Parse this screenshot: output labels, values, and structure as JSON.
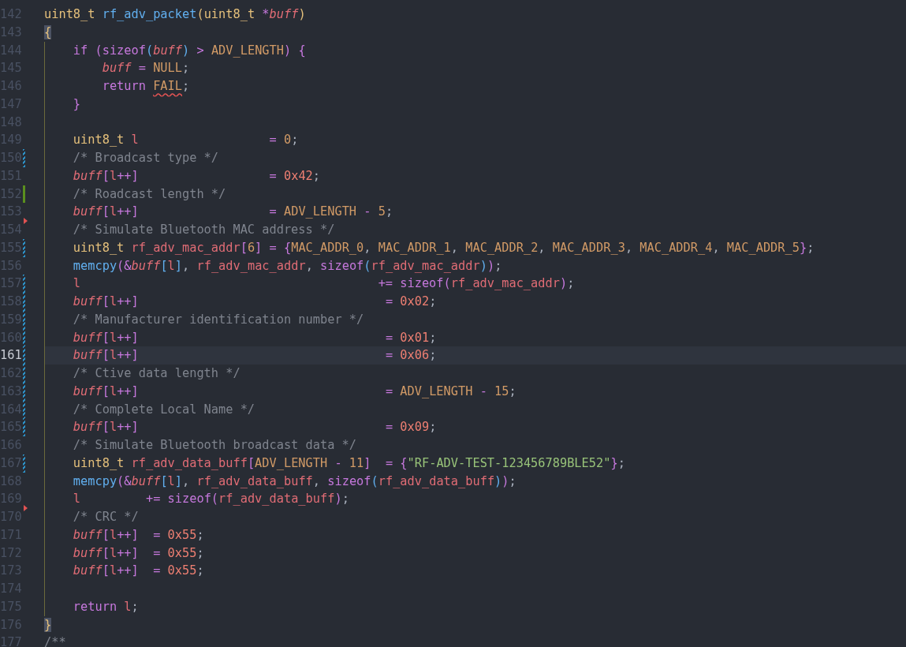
{
  "editor": {
    "lines": [
      {
        "number": "142",
        "current": false,
        "tokens": [
          {
            "text": "uint8_t ",
            "kind": "type"
          },
          {
            "text": "rf_adv_packet",
            "kind": "fn"
          },
          {
            "text": "(",
            "kind": "b1"
          },
          {
            "text": "uint8_t ",
            "kind": "type"
          },
          {
            "text": "*",
            "kind": "op"
          },
          {
            "text": "buff",
            "kind": "param"
          },
          {
            "text": ")",
            "kind": "b1"
          }
        ]
      },
      {
        "number": "143",
        "current": false,
        "tokens": [
          {
            "text": "{",
            "kind": "brace"
          }
        ]
      },
      {
        "number": "144",
        "current": false,
        "tokens": [
          {
            "text": "    if ",
            "kind": "kw"
          },
          {
            "text": "(",
            "kind": "b2"
          },
          {
            "text": "sizeof",
            "kind": "kw"
          },
          {
            "text": "(",
            "kind": "b3"
          },
          {
            "text": "buff",
            "kind": "param"
          },
          {
            "text": ")",
            "kind": "b3"
          },
          {
            "text": " > ",
            "kind": "op"
          },
          {
            "text": "ADV_LENGTH",
            "kind": "macro"
          },
          {
            "text": ") {",
            "kind": "b2"
          }
        ]
      },
      {
        "number": "145",
        "current": false,
        "tokens": [
          {
            "text": "        buff",
            "kind": "param"
          },
          {
            "text": " = ",
            "kind": "op"
          },
          {
            "text": "NULL",
            "kind": "macro"
          },
          {
            "text": ";",
            "kind": "punc"
          }
        ]
      },
      {
        "number": "146",
        "current": false,
        "tokens": [
          {
            "text": "        return ",
            "kind": "kw"
          },
          {
            "text": "FAIL",
            "kind": "error"
          },
          {
            "text": ";",
            "kind": "punc"
          }
        ]
      },
      {
        "number": "147",
        "current": false,
        "tokens": [
          {
            "text": "    }",
            "kind": "b2"
          }
        ]
      },
      {
        "number": "148",
        "current": false
      },
      {
        "number": "149",
        "current": false,
        "tokens": [
          {
            "text": "    uint8_t ",
            "kind": "type"
          },
          {
            "text": "l",
            "kind": "var"
          },
          {
            "text": "                  = ",
            "kind": "op"
          },
          {
            "text": "0",
            "kind": "num"
          },
          {
            "text": ";",
            "kind": "punc"
          }
        ]
      },
      {
        "number": "150",
        "current": false,
        "kind": "modified",
        "tokens": [
          {
            "text": "    /* Broadcast type */",
            "kind": "cmt"
          }
        ]
      },
      {
        "number": "151",
        "current": false,
        "tokens": [
          {
            "text": "    buff",
            "kind": "param"
          },
          {
            "text": "[",
            "kind": "b2"
          },
          {
            "text": "l",
            "kind": "var"
          },
          {
            "text": "++",
            "kind": "op"
          },
          {
            "text": "]",
            "kind": "b2"
          },
          {
            "text": "                  = ",
            "kind": "op"
          },
          {
            "text": "0x42",
            "kind": "hex"
          },
          {
            "text": ";",
            "kind": "punc"
          }
        ]
      },
      {
        "number": "152",
        "current": false,
        "kind": "added",
        "tokens": [
          {
            "text": "    /* Roadcast length */",
            "kind": "cmt"
          }
        ]
      },
      {
        "number": "153",
        "current": false,
        "tokens": [
          {
            "text": "    buff",
            "kind": "param"
          },
          {
            "text": "[",
            "kind": "b2"
          },
          {
            "text": "l",
            "kind": "var"
          },
          {
            "text": "++",
            "kind": "op"
          },
          {
            "text": "]",
            "kind": "b2"
          },
          {
            "text": "                  = ",
            "kind": "op"
          },
          {
            "text": "ADV_LENGTH",
            "kind": "macro"
          },
          {
            "text": " - ",
            "kind": "op"
          },
          {
            "text": "5",
            "kind": "num"
          },
          {
            "text": ";",
            "kind": "punc"
          }
        ]
      },
      {
        "number": "154",
        "current": false,
        "kind": "deleted",
        "tokens": [
          {
            "text": "    /* Simulate Bluetooth MAC address */",
            "kind": "cmt"
          }
        ]
      },
      {
        "number": "155",
        "current": false,
        "kind": "modified",
        "tokens": [
          {
            "text": "    uint8_t ",
            "kind": "type"
          },
          {
            "text": "rf_adv_mac_addr",
            "kind": "var"
          },
          {
            "text": "[",
            "kind": "b2"
          },
          {
            "text": "6",
            "kind": "num"
          },
          {
            "text": "]",
            "kind": "b2"
          },
          {
            "text": " = ",
            "kind": "op"
          },
          {
            "text": "{",
            "kind": "b2"
          },
          {
            "text": "MAC_ADDR_0",
            "kind": "macro"
          },
          {
            "text": ", ",
            "kind": "punc"
          },
          {
            "text": "MAC_ADDR_1",
            "kind": "macro"
          },
          {
            "text": ", ",
            "kind": "punc"
          },
          {
            "text": "MAC_ADDR_2",
            "kind": "macro"
          },
          {
            "text": ", ",
            "kind": "punc"
          },
          {
            "text": "MAC_ADDR_3",
            "kind": "macro"
          },
          {
            "text": ", ",
            "kind": "punc"
          },
          {
            "text": "MAC_ADDR_4",
            "kind": "macro"
          },
          {
            "text": ", ",
            "kind": "punc"
          },
          {
            "text": "MAC_ADDR_5",
            "kind": "macro"
          },
          {
            "text": "}",
            "kind": "b2"
          },
          {
            "text": ";",
            "kind": "punc"
          }
        ]
      },
      {
        "number": "156",
        "current": false,
        "tokens": [
          {
            "text": "    memcpy",
            "kind": "fn"
          },
          {
            "text": "(",
            "kind": "b2"
          },
          {
            "text": "&",
            "kind": "op"
          },
          {
            "text": "buff",
            "kind": "param"
          },
          {
            "text": "[",
            "kind": "b3"
          },
          {
            "text": "l",
            "kind": "var"
          },
          {
            "text": "]",
            "kind": "b3"
          },
          {
            "text": ", ",
            "kind": "punc"
          },
          {
            "text": "rf_adv_mac_addr",
            "kind": "var"
          },
          {
            "text": ", ",
            "kind": "punc"
          },
          {
            "text": "sizeof",
            "kind": "kw"
          },
          {
            "text": "(",
            "kind": "b3"
          },
          {
            "text": "rf_adv_mac_addr",
            "kind": "var"
          },
          {
            "text": ")",
            "kind": "b3"
          },
          {
            "text": ")",
            "kind": "b2"
          },
          {
            "text": ";",
            "kind": "punc"
          }
        ]
      },
      {
        "number": "157",
        "current": false,
        "kind": "modified",
        "tokens": [
          {
            "text": "    l",
            "kind": "var"
          },
          {
            "text": "                                         += ",
            "kind": "op"
          },
          {
            "text": "sizeof",
            "kind": "kw"
          },
          {
            "text": "(",
            "kind": "b2"
          },
          {
            "text": "rf_adv_mac_addr",
            "kind": "var"
          },
          {
            "text": ")",
            "kind": "b2"
          },
          {
            "text": ";",
            "kind": "punc"
          }
        ]
      },
      {
        "number": "158",
        "current": false,
        "kind": "modified",
        "tokens": [
          {
            "text": "    buff",
            "kind": "param"
          },
          {
            "text": "[",
            "kind": "b2"
          },
          {
            "text": "l",
            "kind": "var"
          },
          {
            "text": "++",
            "kind": "op"
          },
          {
            "text": "]",
            "kind": "b2"
          },
          {
            "text": "                                  = ",
            "kind": "op"
          },
          {
            "text": "0x02",
            "kind": "hex"
          },
          {
            "text": ";",
            "kind": "punc"
          }
        ]
      },
      {
        "number": "159",
        "current": false,
        "kind": "modified",
        "tokens": [
          {
            "text": "    /* Manufacturer identification number */",
            "kind": "cmt"
          }
        ]
      },
      {
        "number": "160",
        "current": false,
        "kind": "modified",
        "tokens": [
          {
            "text": "    buff",
            "kind": "param"
          },
          {
            "text": "[",
            "kind": "b2"
          },
          {
            "text": "l",
            "kind": "var"
          },
          {
            "text": "++",
            "kind": "op"
          },
          {
            "text": "]",
            "kind": "b2"
          },
          {
            "text": "                                  = ",
            "kind": "op"
          },
          {
            "text": "0x01",
            "kind": "hex"
          },
          {
            "text": ";",
            "kind": "punc"
          }
        ]
      },
      {
        "number": "161",
        "current": true,
        "kind": "modified",
        "tokens": [
          {
            "text": "    buff",
            "kind": "param"
          },
          {
            "text": "[",
            "kind": "b2"
          },
          {
            "text": "l",
            "kind": "var"
          },
          {
            "text": "++",
            "kind": "op"
          },
          {
            "text": "]",
            "kind": "b2"
          },
          {
            "text": "                                  = ",
            "kind": "op"
          },
          {
            "text": "0x06",
            "kind": "hex"
          },
          {
            "text": ";",
            "kind": "punc"
          }
        ]
      },
      {
        "number": "162",
        "current": false,
        "kind": "modified",
        "tokens": [
          {
            "text": "    /* Ctive data length */",
            "kind": "cmt"
          }
        ]
      },
      {
        "number": "163",
        "current": false,
        "kind": "modified",
        "tokens": [
          {
            "text": "    buff",
            "kind": "param"
          },
          {
            "text": "[",
            "kind": "b2"
          },
          {
            "text": "l",
            "kind": "var"
          },
          {
            "text": "++",
            "kind": "op"
          },
          {
            "text": "]",
            "kind": "b2"
          },
          {
            "text": "                                  = ",
            "kind": "op"
          },
          {
            "text": "ADV_LENGTH",
            "kind": "macro"
          },
          {
            "text": " - ",
            "kind": "op"
          },
          {
            "text": "15",
            "kind": "num"
          },
          {
            "text": ";",
            "kind": "punc"
          }
        ]
      },
      {
        "number": "164",
        "current": false,
        "kind": "modified",
        "tokens": [
          {
            "text": "    /* Complete Local Name */",
            "kind": "cmt"
          }
        ]
      },
      {
        "number": "165",
        "current": false,
        "kind": "modified",
        "tokens": [
          {
            "text": "    buff",
            "kind": "param"
          },
          {
            "text": "[",
            "kind": "b2"
          },
          {
            "text": "l",
            "kind": "var"
          },
          {
            "text": "++",
            "kind": "op"
          },
          {
            "text": "]",
            "kind": "b2"
          },
          {
            "text": "                                  = ",
            "kind": "op"
          },
          {
            "text": "0x09",
            "kind": "hex"
          },
          {
            "text": ";",
            "kind": "punc"
          }
        ]
      },
      {
        "number": "166",
        "current": false,
        "tokens": [
          {
            "text": "    /* Simulate Bluetooth broadcast data */",
            "kind": "cmt"
          }
        ]
      },
      {
        "number": "167",
        "current": false,
        "kind": "modified",
        "tokens": [
          {
            "text": "    uint8_t ",
            "kind": "type"
          },
          {
            "text": "rf_adv_data_buff",
            "kind": "var"
          },
          {
            "text": "[",
            "kind": "b2"
          },
          {
            "text": "ADV_LENGTH",
            "kind": "macro"
          },
          {
            "text": " - ",
            "kind": "op"
          },
          {
            "text": "11",
            "kind": "num"
          },
          {
            "text": "]",
            "kind": "b2"
          },
          {
            "text": "  = ",
            "kind": "op"
          },
          {
            "text": "{",
            "kind": "b2"
          },
          {
            "text": "\"RF-ADV-TEST-123456789BLE52\"",
            "kind": "str"
          },
          {
            "text": "}",
            "kind": "b2"
          },
          {
            "text": ";",
            "kind": "punc"
          }
        ]
      },
      {
        "number": "168",
        "current": false,
        "tokens": [
          {
            "text": "    memcpy",
            "kind": "fn"
          },
          {
            "text": "(",
            "kind": "b2"
          },
          {
            "text": "&",
            "kind": "op"
          },
          {
            "text": "buff",
            "kind": "param"
          },
          {
            "text": "[",
            "kind": "b3"
          },
          {
            "text": "l",
            "kind": "var"
          },
          {
            "text": "]",
            "kind": "b3"
          },
          {
            "text": ", ",
            "kind": "punc"
          },
          {
            "text": "rf_adv_data_buff",
            "kind": "var"
          },
          {
            "text": ", ",
            "kind": "punc"
          },
          {
            "text": "sizeof",
            "kind": "kw"
          },
          {
            "text": "(",
            "kind": "b3"
          },
          {
            "text": "rf_adv_data_buff",
            "kind": "var"
          },
          {
            "text": ")",
            "kind": "b3"
          },
          {
            "text": ")",
            "kind": "b2"
          },
          {
            "text": ";",
            "kind": "punc"
          }
        ]
      },
      {
        "number": "169",
        "current": false,
        "tokens": [
          {
            "text": "    l",
            "kind": "var"
          },
          {
            "text": "         += ",
            "kind": "op"
          },
          {
            "text": "sizeof",
            "kind": "kw"
          },
          {
            "text": "(",
            "kind": "b2"
          },
          {
            "text": "rf_adv_data_buff",
            "kind": "var"
          },
          {
            "text": ")",
            "kind": "b2"
          },
          {
            "text": ";",
            "kind": "punc"
          }
        ]
      },
      {
        "number": "170",
        "current": false,
        "kind": "deleted",
        "tokens": [
          {
            "text": "    /* CRC */",
            "kind": "cmt"
          }
        ]
      },
      {
        "number": "171",
        "current": false,
        "tokens": [
          {
            "text": "    buff",
            "kind": "param"
          },
          {
            "text": "[",
            "kind": "b2"
          },
          {
            "text": "l",
            "kind": "var"
          },
          {
            "text": "++",
            "kind": "op"
          },
          {
            "text": "]",
            "kind": "b2"
          },
          {
            "text": "  = ",
            "kind": "op"
          },
          {
            "text": "0x55",
            "kind": "hex"
          },
          {
            "text": ";",
            "kind": "punc"
          }
        ]
      },
      {
        "number": "172",
        "current": false,
        "tokens": [
          {
            "text": "    buff",
            "kind": "param"
          },
          {
            "text": "[",
            "kind": "b2"
          },
          {
            "text": "l",
            "kind": "var"
          },
          {
            "text": "++",
            "kind": "op"
          },
          {
            "text": "]",
            "kind": "b2"
          },
          {
            "text": "  = ",
            "kind": "op"
          },
          {
            "text": "0x55",
            "kind": "hex"
          },
          {
            "text": ";",
            "kind": "punc"
          }
        ]
      },
      {
        "number": "173",
        "current": false,
        "tokens": [
          {
            "text": "    buff",
            "kind": "param"
          },
          {
            "text": "[",
            "kind": "b2"
          },
          {
            "text": "l",
            "kind": "var"
          },
          {
            "text": "++",
            "kind": "op"
          },
          {
            "text": "]",
            "kind": "b2"
          },
          {
            "text": "  = ",
            "kind": "op"
          },
          {
            "text": "0x55",
            "kind": "hex"
          },
          {
            "text": ";",
            "kind": "punc"
          }
        ]
      },
      {
        "number": "174",
        "current": false
      },
      {
        "number": "175",
        "current": false,
        "tokens": [
          {
            "text": "    return ",
            "kind": "kw"
          },
          {
            "text": "l",
            "kind": "var"
          },
          {
            "text": ";",
            "kind": "punc"
          }
        ]
      },
      {
        "number": "176",
        "current": false,
        "tokens": [
          {
            "text": "}",
            "kind": "brace"
          }
        ]
      },
      {
        "number": "177",
        "current": false,
        "tokens": [
          {
            "text": "/**",
            "kind": "cmt"
          }
        ]
      }
    ]
  }
}
